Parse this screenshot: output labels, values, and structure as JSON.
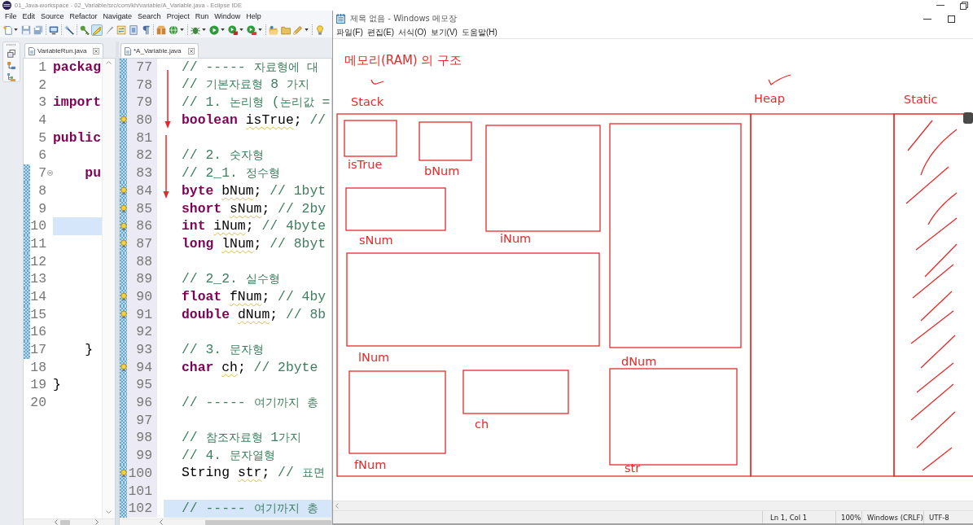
{
  "eclipse": {
    "title": "01_Java-workspace - 02_Variable/src/com/kh/variable/A_Variable.java - Eclipse IDE",
    "menu": [
      "File",
      "Edit",
      "Source",
      "Refactor",
      "Navigate",
      "Search",
      "Project",
      "Run",
      "Window",
      "Help"
    ],
    "toolbar": [
      [
        {
          "kind": "new",
          "menu": true,
          "selected": false
        },
        {
          "kind": "save",
          "menu": false,
          "selected": false
        },
        {
          "kind": "save-all",
          "menu": false,
          "selected": false
        }
      ],
      [
        {
          "kind": "terminal",
          "menu": false,
          "selected": false
        }
      ],
      [
        {
          "kind": "wand",
          "menu": false,
          "selected": false
        }
      ],
      [
        {
          "kind": "key",
          "menu": false,
          "selected": false
        },
        {
          "kind": "highlighter",
          "menu": false,
          "selected": true
        },
        {
          "kind": "brush",
          "menu": false,
          "selected": false
        },
        {
          "kind": "compare",
          "menu": false,
          "selected": false
        },
        {
          "kind": "frame",
          "menu": false,
          "selected": false
        },
        {
          "kind": "pilcrow",
          "menu": false,
          "selected": false
        }
      ],
      [
        {
          "kind": "package",
          "menu": false,
          "selected": false
        },
        {
          "kind": "globe",
          "menu": true,
          "selected": false
        }
      ],
      [
        {
          "kind": "bug",
          "menu": true,
          "selected": false
        },
        {
          "kind": "run",
          "menu": true,
          "selected": false
        },
        {
          "kind": "coverage",
          "menu": true,
          "selected": false
        },
        {
          "kind": "external",
          "menu": true,
          "selected": false
        }
      ],
      [
        {
          "kind": "open-type",
          "menu": false,
          "selected": false
        },
        {
          "kind": "folder",
          "menu": false,
          "selected": false
        },
        {
          "kind": "pencil",
          "menu": true,
          "selected": false
        }
      ],
      [
        {
          "kind": "bulb",
          "menu": false,
          "selected": false
        }
      ]
    ],
    "editors": [
      {
        "tab": {
          "label": "VariableRun.java",
          "selected": true
        },
        "lines": [
          {
            "number": "1",
            "tokens": [
              {
                "kind": "keyword",
                "text": "packag"
              }
            ],
            "changed": false,
            "warning": false,
            "current": false,
            "fold": false
          },
          {
            "number": "2",
            "changed": false,
            "warning": false,
            "current": false,
            "fold": false
          },
          {
            "number": "3",
            "tokens": [
              {
                "kind": "keyword",
                "text": "import"
              }
            ],
            "changed": false,
            "warning": false,
            "current": false,
            "fold": false
          },
          {
            "number": "4",
            "changed": false,
            "warning": false,
            "current": false,
            "fold": false
          },
          {
            "number": "5",
            "tokens": [
              {
                "kind": "keyword",
                "text": "public"
              }
            ],
            "changed": false,
            "warning": false,
            "current": false,
            "fold": false
          },
          {
            "number": "6",
            "changed": false,
            "warning": false,
            "current": false,
            "fold": false
          },
          {
            "number": "7",
            "tokens": [
              {
                "kind": "keyword",
                "text": "    pu"
              }
            ],
            "changed": true,
            "warning": false,
            "current": false,
            "fold": true
          },
          {
            "number": "8",
            "changed": true,
            "warning": false,
            "current": false,
            "fold": false
          },
          {
            "number": "9",
            "changed": true,
            "warning": false,
            "current": false,
            "fold": false
          },
          {
            "number": "10",
            "changed": true,
            "warning": false,
            "current": true,
            "fold": false
          },
          {
            "number": "11",
            "changed": true,
            "warning": false,
            "current": false,
            "fold": false
          },
          {
            "number": "12",
            "changed": true,
            "warning": false,
            "current": false,
            "fold": false
          },
          {
            "number": "13",
            "changed": true,
            "warning": false,
            "current": false,
            "fold": false
          },
          {
            "number": "14",
            "changed": true,
            "warning": false,
            "current": false,
            "fold": false
          },
          {
            "number": "15",
            "changed": true,
            "warning": false,
            "current": false,
            "fold": false
          },
          {
            "number": "16",
            "changed": true,
            "warning": false,
            "current": false,
            "fold": false
          },
          {
            "number": "17",
            "tokens": [
              {
                "kind": "plain",
                "text": "    }"
              }
            ],
            "changed": true,
            "warning": false,
            "current": false,
            "fold": false
          },
          {
            "number": "18",
            "changed": false,
            "warning": false,
            "current": false,
            "fold": false
          },
          {
            "number": "19",
            "tokens": [
              {
                "kind": "plain",
                "text": "}"
              }
            ],
            "changed": false,
            "warning": false,
            "current": false,
            "fold": false
          },
          {
            "number": "20",
            "changed": false,
            "warning": false,
            "current": false,
            "fold": false
          }
        ]
      },
      {
        "tab": {
          "label": "*A_Variable.java",
          "selected": true
        },
        "lines": [
          {
            "number": "77",
            "tokens": [
              {
                "kind": "comment",
                "text": "// ----- 자료형에 대"
              }
            ],
            "changed": true,
            "warning": false,
            "current": false,
            "fold": false
          },
          {
            "number": "78",
            "tokens": [
              {
                "kind": "comment",
                "text": "// 기본자료형 8 가지"
              }
            ],
            "changed": true,
            "warning": false,
            "current": false,
            "fold": false
          },
          {
            "number": "79",
            "tokens": [
              {
                "kind": "comment",
                "text": "// 1. 논리형 (논리값 ="
              }
            ],
            "changed": true,
            "warning": false,
            "current": false,
            "fold": false
          },
          {
            "number": "80",
            "tokens": [
              {
                "kind": "keyword",
                "text": "boolean"
              },
              {
                "kind": "unused",
                "text": " isTrue"
              },
              {
                "kind": "plain",
                "text": ";"
              },
              {
                "kind": "comment",
                "text": " //"
              }
            ],
            "changed": true,
            "warning": true,
            "current": false,
            "fold": false
          },
          {
            "number": "81",
            "changed": true,
            "warning": false,
            "current": false,
            "fold": false
          },
          {
            "number": "82",
            "tokens": [
              {
                "kind": "comment",
                "text": "// 2. 숫자형"
              }
            ],
            "changed": true,
            "warning": false,
            "current": false,
            "fold": false
          },
          {
            "number": "83",
            "tokens": [
              {
                "kind": "comment",
                "text": "// 2_1. 정수형"
              }
            ],
            "changed": true,
            "warning": false,
            "current": false,
            "fold": false
          },
          {
            "number": "84",
            "tokens": [
              {
                "kind": "keyword",
                "text": "byte"
              },
              {
                "kind": "unused",
                "text": " bNum"
              },
              {
                "kind": "plain",
                "text": ";"
              },
              {
                "kind": "comment",
                "text": " // 1byt"
              }
            ],
            "changed": true,
            "warning": true,
            "current": false,
            "fold": false
          },
          {
            "number": "85",
            "tokens": [
              {
                "kind": "keyword",
                "text": "short"
              },
              {
                "kind": "unused",
                "text": " sNum"
              },
              {
                "kind": "plain",
                "text": ";"
              },
              {
                "kind": "comment",
                "text": " // 2by"
              }
            ],
            "changed": true,
            "warning": true,
            "current": false,
            "fold": false
          },
          {
            "number": "86",
            "tokens": [
              {
                "kind": "keyword",
                "text": "int"
              },
              {
                "kind": "unused",
                "text": " iNum"
              },
              {
                "kind": "plain",
                "text": ";"
              },
              {
                "kind": "comment",
                "text": " // 4byte"
              }
            ],
            "changed": true,
            "warning": true,
            "current": false,
            "fold": false
          },
          {
            "number": "87",
            "tokens": [
              {
                "kind": "keyword",
                "text": "long"
              },
              {
                "kind": "unused",
                "text": " lNum"
              },
              {
                "kind": "plain",
                "text": ";"
              },
              {
                "kind": "comment",
                "text": " // 8byt"
              }
            ],
            "changed": true,
            "warning": true,
            "current": false,
            "fold": false
          },
          {
            "number": "88",
            "changed": true,
            "warning": false,
            "current": false,
            "fold": false
          },
          {
            "number": "89",
            "tokens": [
              {
                "kind": "comment",
                "text": "// 2_2. 실수형"
              }
            ],
            "changed": true,
            "warning": false,
            "current": false,
            "fold": false
          },
          {
            "number": "90",
            "tokens": [
              {
                "kind": "keyword",
                "text": "float"
              },
              {
                "kind": "unused",
                "text": " fNum"
              },
              {
                "kind": "plain",
                "text": ";"
              },
              {
                "kind": "comment",
                "text": " // 4by"
              }
            ],
            "changed": true,
            "warning": true,
            "current": false,
            "fold": false
          },
          {
            "number": "91",
            "tokens": [
              {
                "kind": "keyword",
                "text": "double"
              },
              {
                "kind": "unused",
                "text": " dNum"
              },
              {
                "kind": "plain",
                "text": ";"
              },
              {
                "kind": "comment",
                "text": " // 8b"
              }
            ],
            "changed": true,
            "warning": true,
            "current": false,
            "fold": false
          },
          {
            "number": "92",
            "changed": true,
            "warning": false,
            "current": false,
            "fold": false
          },
          {
            "number": "93",
            "tokens": [
              {
                "kind": "comment",
                "text": "// 3. 문자형"
              }
            ],
            "changed": true,
            "warning": false,
            "current": false,
            "fold": false
          },
          {
            "number": "94",
            "tokens": [
              {
                "kind": "keyword",
                "text": "char"
              },
              {
                "kind": "unused",
                "text": " ch"
              },
              {
                "kind": "plain",
                "text": ";"
              },
              {
                "kind": "comment",
                "text": " // 2byte"
              }
            ],
            "changed": true,
            "warning": true,
            "current": false,
            "fold": false
          },
          {
            "number": "95",
            "changed": true,
            "warning": false,
            "current": false,
            "fold": false
          },
          {
            "number": "96",
            "tokens": [
              {
                "kind": "comment",
                "text": "// ----- 여기까지 총"
              }
            ],
            "changed": true,
            "warning": false,
            "current": false,
            "fold": false
          },
          {
            "number": "97",
            "changed": true,
            "warning": false,
            "current": false,
            "fold": false
          },
          {
            "number": "98",
            "tokens": [
              {
                "kind": "comment",
                "text": "// 참조자료형 1가지"
              }
            ],
            "changed": true,
            "warning": false,
            "current": false,
            "fold": false
          },
          {
            "number": "99",
            "tokens": [
              {
                "kind": "comment",
                "text": "// 4. 문자열형"
              }
            ],
            "changed": true,
            "warning": false,
            "current": false,
            "fold": false
          },
          {
            "number": "100",
            "tokens": [
              {
                "kind": "plain",
                "text": "String"
              },
              {
                "kind": "unused",
                "text": " str"
              },
              {
                "kind": "plain",
                "text": ";"
              },
              {
                "kind": "comment",
                "text": " // 표면"
              }
            ],
            "changed": true,
            "warning": true,
            "current": false,
            "fold": false
          },
          {
            "number": "101",
            "changed": true,
            "warning": false,
            "current": false,
            "fold": false
          },
          {
            "number": "102",
            "tokens": [
              {
                "kind": "comment",
                "text": "// ----- 여기까지 총"
              }
            ],
            "changed": true,
            "warning": false,
            "current": true,
            "fold": false
          }
        ]
      }
    ]
  },
  "notepad": {
    "title": "제목 없음 - Windows 메모장",
    "menu": [
      "파일(F)",
      "편집(E)",
      "서식(O)",
      "보기(V)",
      "도움말(H)"
    ],
    "drawing": {
      "heading": "메모리(RAM) 의 구조",
      "areas": [
        "Stack",
        "Heap",
        "Static"
      ],
      "variables": [
        "isTrue",
        "bNum",
        "sNum",
        "iNum",
        "lNum",
        "dNum",
        "fNum",
        "ch",
        "str"
      ]
    },
    "status_bar": [
      "Ln 1, Col 1",
      "100%",
      "Windows (CRLF)",
      "UTF-8"
    ]
  }
}
